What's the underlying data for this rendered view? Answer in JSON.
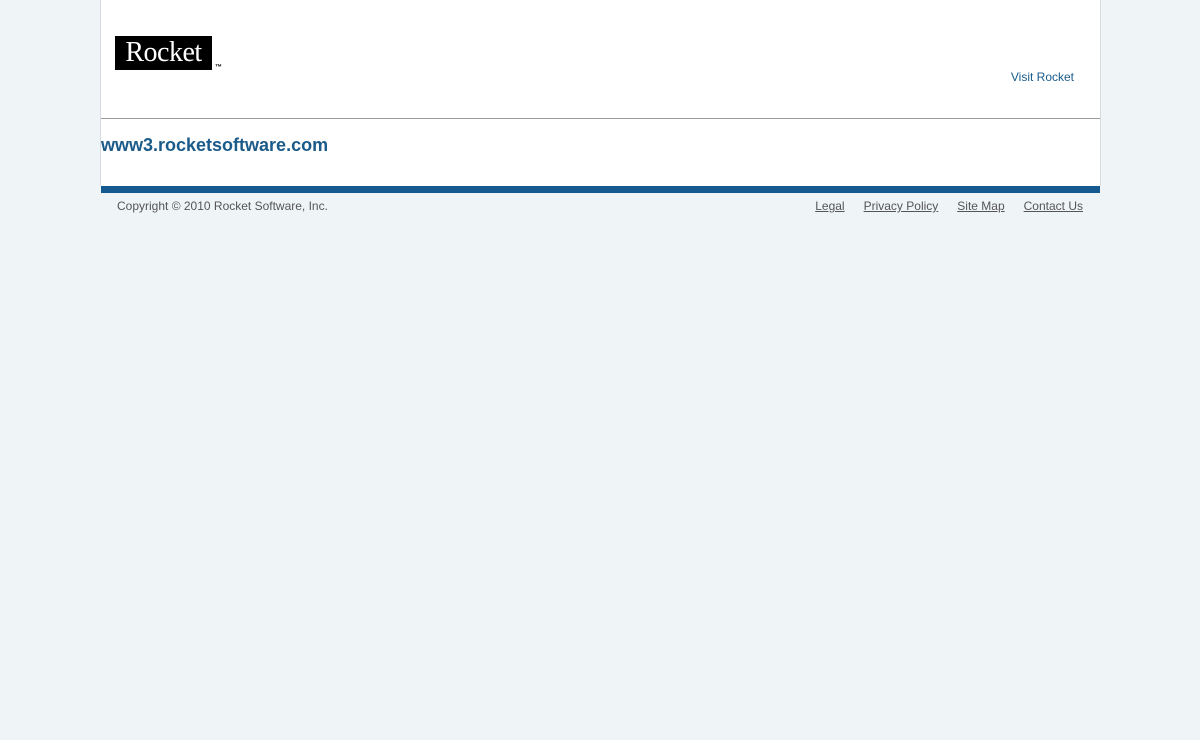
{
  "header": {
    "logo_text": "Rocket",
    "logo_tm": "™",
    "visit_link": "Visit Rocket"
  },
  "main": {
    "site_title": "www3.rocketsoftware.com"
  },
  "footer": {
    "copyright": "Copyright © 2010 Rocket Software, Inc.",
    "links": [
      {
        "label": "Legal"
      },
      {
        "label": "Privacy Policy"
      },
      {
        "label": "Site Map"
      },
      {
        "label": "Contact Us"
      }
    ]
  },
  "colors": {
    "brand_blue": "#145a91",
    "link_blue": "#1a5b8a",
    "background": "#eff4f7"
  }
}
